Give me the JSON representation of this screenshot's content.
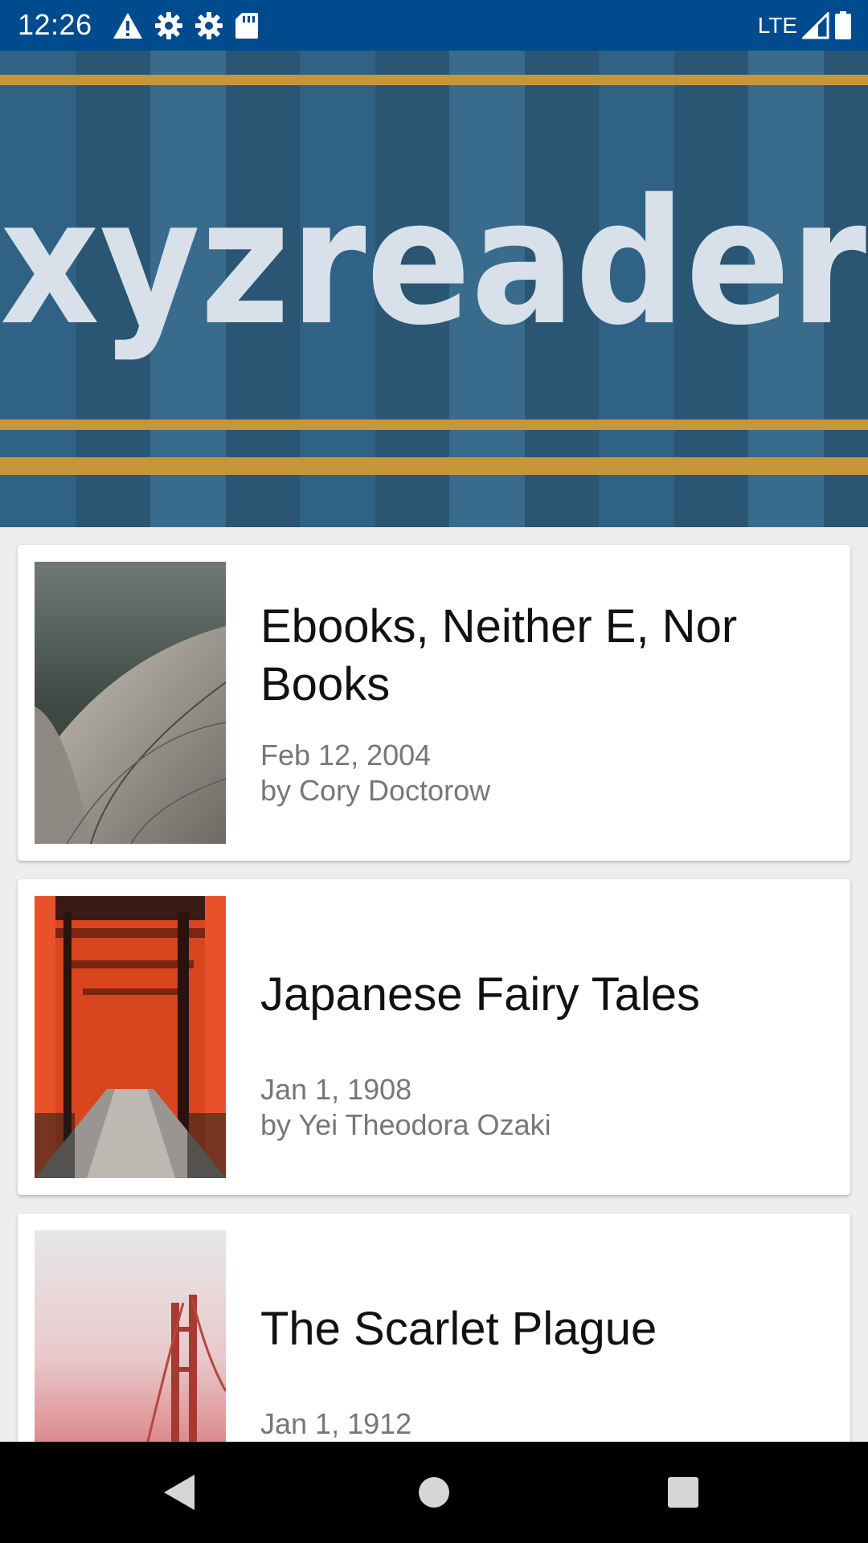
{
  "status_bar": {
    "time": "12:26",
    "network": "LTE",
    "icons": [
      "warning-icon",
      "gear-icon",
      "gear-icon",
      "sd-card-icon",
      "signal-icon",
      "battery-icon"
    ]
  },
  "header": {
    "logo_text": "xyzreader",
    "colors": {
      "background": "#2f6285",
      "stripe": "#c8963a",
      "text": "#d8e1e9"
    }
  },
  "articles": [
    {
      "title": "Ebooks, Neither E, Nor Books",
      "date": "Feb 12, 2004",
      "author": "by Cory Doctorow",
      "thumbnail": "opera-house-roof-photo"
    },
    {
      "title": "Japanese Fairy Tales",
      "date": "Jan 1, 1908",
      "author": "by Yei Theodora Ozaki",
      "thumbnail": "torii-gates-path-photo"
    },
    {
      "title": "The Scarlet Plague",
      "date": "Jan 1, 1912",
      "author": "",
      "thumbnail": "golden-gate-bridge-fog-photo"
    }
  ],
  "nav_bar": {
    "icons": [
      "back-icon",
      "home-icon",
      "recents-icon"
    ]
  }
}
